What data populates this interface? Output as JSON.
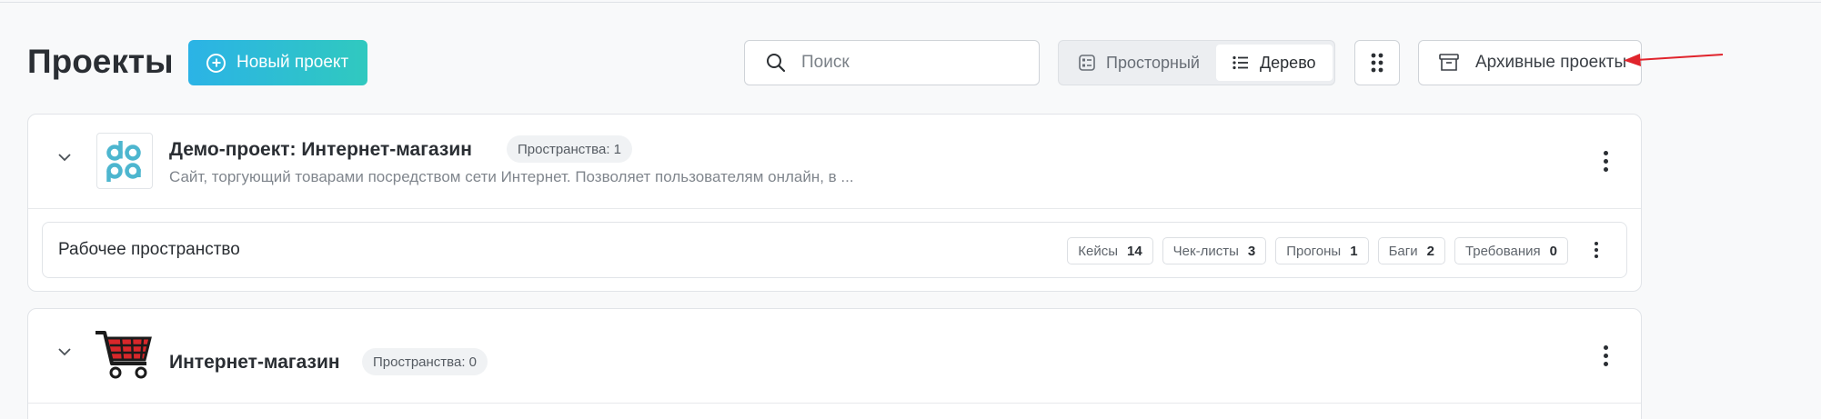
{
  "header": {
    "title": "Проекты",
    "new_project_label": "Новый проект",
    "search_placeholder": "Поиск",
    "view_options": [
      {
        "label": "Просторный",
        "active": false
      },
      {
        "label": "Дерево",
        "active": true
      }
    ],
    "archive_label": "Архивные проекты"
  },
  "colors": {
    "accent_start": "#2bb3e6",
    "accent_end": "#30c9bf",
    "annotation_arrow": "#e0242c"
  },
  "projects": [
    {
      "name": "Демо-проект: Интернет-магазин",
      "spaces_badge": "Пространства: 1",
      "description": "Сайт, торгующий товарами посредством сети Интернет. Позволяет пользователям онлайн, в ...",
      "logo": "doqa-logo",
      "workspaces": [
        {
          "name": "Рабочее пространство",
          "stats": [
            {
              "label": "Кейсы",
              "value": "14"
            },
            {
              "label": "Чек-листы",
              "value": "3"
            },
            {
              "label": "Прогоны",
              "value": "1"
            },
            {
              "label": "Баги",
              "value": "2"
            },
            {
              "label": "Требования",
              "value": "0"
            }
          ]
        }
      ]
    },
    {
      "name": "Интернет-магазин",
      "spaces_badge": "Пространства: 0",
      "logo": "shopping-cart-logo"
    }
  ]
}
